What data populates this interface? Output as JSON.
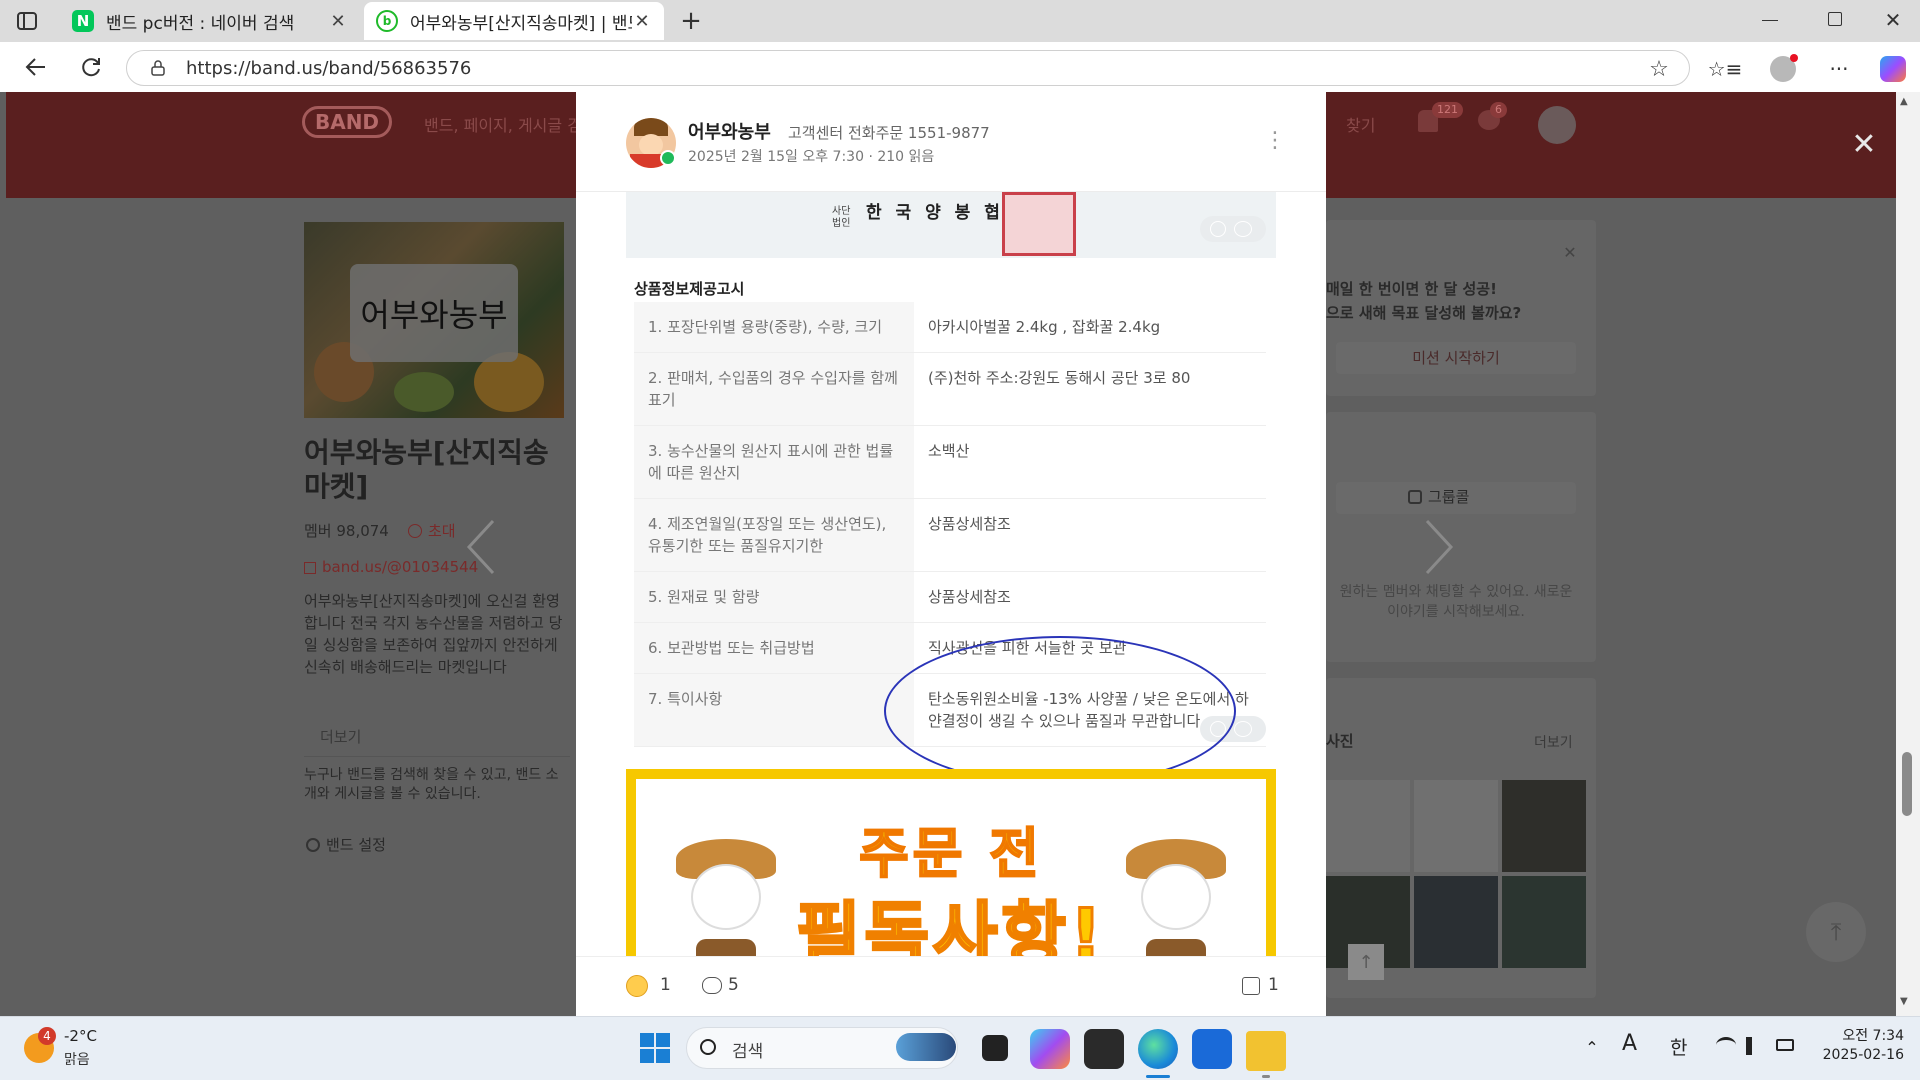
{
  "browser": {
    "tabs": [
      {
        "title": "밴드 pc버전 : 네이버 검색",
        "favicon": "N"
      },
      {
        "title": "어부와농부[산지직송마켓] | 밴드",
        "favicon": "band"
      }
    ],
    "url": "https://band.us/band/56863576"
  },
  "band_header": {
    "logo": "BAND",
    "search_placeholder": "밴드, 페이지, 게시글 검",
    "find": "찾기",
    "notif_count": "121",
    "chat_count": "6"
  },
  "left_panel": {
    "cover_label": "어부와농부",
    "band_name": "어부와농부[산지직송마켓]",
    "members": "멤버 98,074",
    "invite": "초대",
    "link": "band.us/@01034544",
    "description": "어부와농부[산지직송마켓]에 오신걸 환영합니다 전국 각지 농수산물을 저렴하고 당일 싱싱함을 보존하여 집앞까지 안전하게 신속히 배송해드리는 마켓입니다",
    "more": "더보기",
    "public_note": "누구나 밴드를 검색해 찾을 수 있고, 밴드 소개와 게시글을 볼 수 있습니다.",
    "settings": "밴드 설정"
  },
  "right_panel": {
    "mission_line1": "매일 한 번이면 한 달 성공!",
    "mission_line2": "으로 새해 목표 달성해 볼까요?",
    "mission_button": "미션 시작하기",
    "group_call": "그룹콜",
    "group_call_desc": "원하는 멤버와 채팅할 수 있어요. 새로운 이야기를 시작해보세요.",
    "photos_title": "사진",
    "photos_more": "더보기"
  },
  "post": {
    "author": "어부와농부",
    "author_sub": "고객센터 전화주문 1551-9877",
    "meta": "2025년 2월 15일 오후 7:30 · 210 읽음",
    "top_image_text": "한 국 양 봉 협 회",
    "top_image_small": "사단 법인",
    "section_title": "상품정보제공고시",
    "rows": [
      {
        "k": "1. 포장단위별 용량(중량), 수량, 크기",
        "v": "아카시아벌꿀 2.4kg , 잡화꿀 2.4kg"
      },
      {
        "k": "2. 판매처, 수입품의 경우 수입자를 함께 표기",
        "v": "(주)천하 주소:강원도 동해시 공단 3로 80"
      },
      {
        "k": "3. 농수산물의 원산지 표시에 관한 법률에 따른 원산지",
        "v": "소백산"
      },
      {
        "k": "4. 제조연월일(포장일 또는 생산연도), 유통기한 또는 품질유지기한",
        "v": "상품상세참조"
      },
      {
        "k": "5. 원재료 및 함량",
        "v": "상품상세참조"
      },
      {
        "k": "6. 보관방법 또는 취급방법",
        "v": "직사광선을 피한 서늘한 곳 보관"
      },
      {
        "k": "7. 특이사항",
        "v": "탄소동위원소비율 -13% 사양꿀 / 낮은 온도에서 하얀결정이 생길 수 있으나 품질과 무관합니다."
      }
    ],
    "banner_line1": "주문 전",
    "banner_line2": "필독사항!",
    "reactions": "1",
    "comments": "5",
    "shares": "1"
  },
  "taskbar": {
    "weather_badge": "4",
    "temp": "-2°C",
    "condition": "맑음",
    "search_label": "검색",
    "ime": "한",
    "font_indicator": "A",
    "time": "오전 7:34",
    "date": "2025-02-16"
  }
}
